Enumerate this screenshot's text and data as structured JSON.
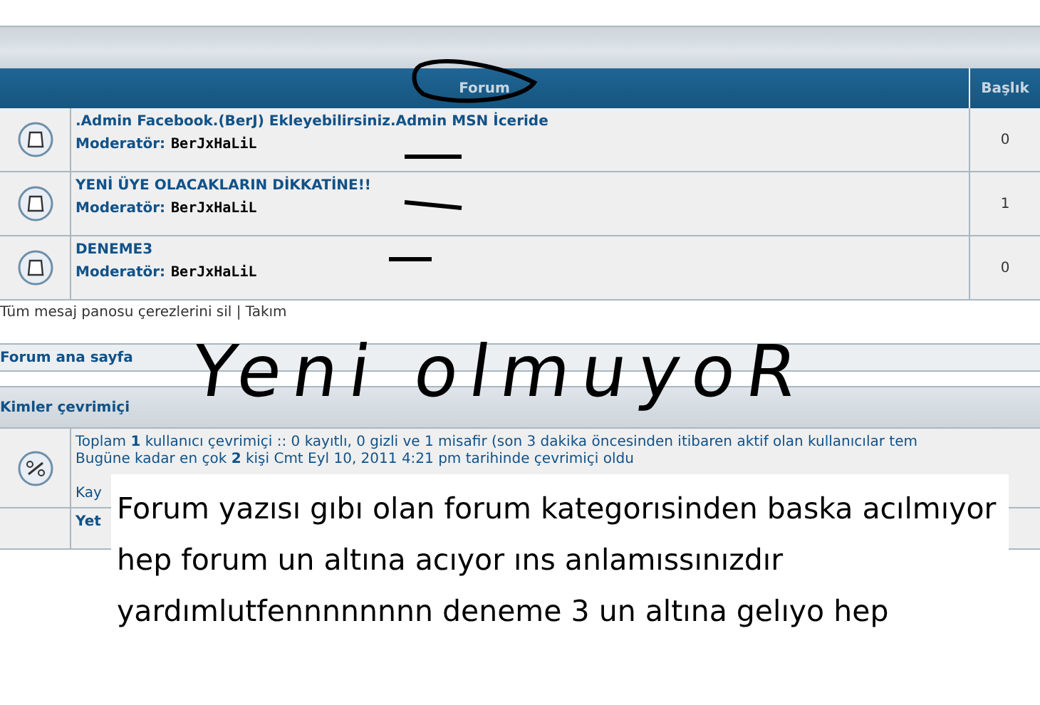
{
  "forum_table": {
    "columns": [
      "Forum",
      "Başlık"
    ],
    "rows": [
      {
        "title": ".Admin Facebook.(BerJ) Ekleyebilirsiniz.Admin MSN İceride",
        "moderator_label": "Moderatör:",
        "moderator": "BerJxHaLiL",
        "topics": "0"
      },
      {
        "title": "YENİ ÜYE OLACAKLARIN DİKKATİNE!!",
        "moderator_label": "Moderatör:",
        "moderator": "BerJxHaLiL",
        "topics": "1"
      },
      {
        "title": "DENEME3",
        "moderator_label": "Moderatör:",
        "moderator": "BerJxHaLiL",
        "topics": "0"
      }
    ]
  },
  "footer_links": "Tüm mesaj panosu çerezlerini sil | Takım",
  "breadcrumb": "Forum ana sayfa",
  "who_is_online": {
    "title": "Kimler çevrimiçi",
    "lines": [
      "Toplam **1** kullanıcı çevrimiçi :: 0 kayıtlı, 0 gizli ve 1 misafir (son 3 dakika öncesinden itibaren aktif olan kullanıcılar tem",
      "Bugüne kadar en çok **2** kişi Cmt Eyl 10, 2011 4:21 pm tarihinde çevrimiçi oldu"
    ],
    "line_3": "Kay",
    "legend": "Yet"
  },
  "handwritten_note": "Yeni olmuyoR",
  "comment_box": "Forum yazısı gıbı olan forum kategorısinden baska acılmıyor hep forum un altına acıyor ıns anlamıssınızdır  yardımlutfennnnnnnn deneme 3 un altına gelıyo hep"
}
